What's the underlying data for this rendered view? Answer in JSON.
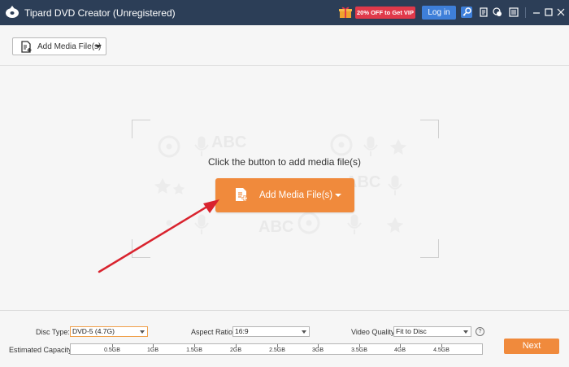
{
  "titlebar": {
    "app_title": "Tipard DVD Creator (Unregistered)",
    "promo_text": "20% OFF to Get VIP",
    "login_label": "Log in",
    "icons": [
      "gift-icon",
      "key-icon",
      "register-icon",
      "feedback-icon",
      "menu-icon",
      "minimize-icon",
      "maximize-icon",
      "close-icon"
    ]
  },
  "toolbar": {
    "add_media_label": "Add Media File(s)"
  },
  "main": {
    "prompt": "Click the button to add media file(s)",
    "add_media_label": "Add Media File(s)",
    "watermark_text": "ABC"
  },
  "bottom": {
    "disc_type_label": "Disc Type:",
    "disc_type_value": "DVD-5 (4.7G)",
    "aspect_ratio_label": "Aspect Ratio:",
    "aspect_ratio_value": "16:9",
    "video_quality_label": "Video Quality:",
    "video_quality_value": "Fit to Disc",
    "capacity_label": "Estimated Capacity:",
    "capacity_ticks": [
      "0.5GB",
      "1GB",
      "1.5GB",
      "2GB",
      "2.5GB",
      "3GB",
      "3.5GB",
      "4GB",
      "4.5GB"
    ],
    "next_label": "Next"
  },
  "colors": {
    "titlebar_bg": "#2c3e57",
    "accent_orange": "#f08a3c",
    "promo_red": "#e0394a",
    "login_blue": "#3e7fd9",
    "arrow_red": "#d9232e"
  }
}
